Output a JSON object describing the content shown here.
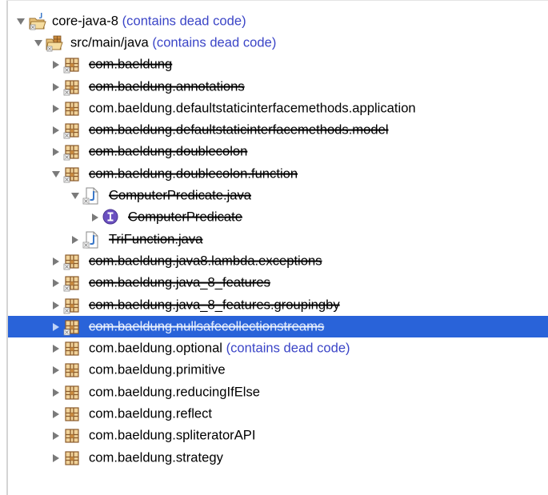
{
  "explorer": {
    "project": {
      "name": "core-java-8",
      "badge": "(contains dead code)"
    },
    "source_folder": {
      "name": "src/main/java",
      "badge": "(contains dead code)"
    },
    "items": [
      {
        "label": "com.baeldung",
        "dead": true
      },
      {
        "label": "com.baeldung.annotations",
        "dead": true
      },
      {
        "label": "com.baeldung.defaultstaticinterfacemethods.application",
        "dead": false
      },
      {
        "label": "com.baeldung.defaultstaticinterfacemethods.model",
        "dead": true
      },
      {
        "label": "com.baeldung.doublecolon",
        "dead": true
      },
      {
        "label": "com.baeldung.doublecolon.function",
        "dead": true,
        "expanded": true
      },
      {
        "label": "ComputerPredicate.java",
        "dead": true,
        "expanded": true,
        "type": "java-file"
      },
      {
        "label": "ComputerPredicate",
        "dead": true,
        "type": "interface"
      },
      {
        "label": "TriFunction.java",
        "dead": true,
        "type": "java-file"
      },
      {
        "label": "com.baeldung.java8.lambda.exceptions",
        "dead": true
      },
      {
        "label": "com.baeldung.java_8_features",
        "dead": true
      },
      {
        "label": "com.baeldung.java_8_features.groupingby",
        "dead": true
      },
      {
        "label": "com.baeldung.nullsafecollectionstreams",
        "dead": true,
        "selected": true
      },
      {
        "label": "com.baeldung.optional",
        "dead": false,
        "badge": "(contains dead code)"
      },
      {
        "label": "com.baeldung.primitive",
        "dead": false
      },
      {
        "label": "com.baeldung.reducingIfElse",
        "dead": false
      },
      {
        "label": "com.baeldung.reflect",
        "dead": false
      },
      {
        "label": "com.baeldung.spliteratorAPI",
        "dead": false
      },
      {
        "label": "com.baeldung.strategy",
        "dead": false
      }
    ],
    "colors": {
      "selection": "#2963d9",
      "badge_text": "#3b45c7",
      "package_brown": "#8a5a2b",
      "package_fill": "#f1d39a",
      "java_file_blue": "#3b78c9",
      "interface_purple": "#6a4fc0"
    },
    "icons": [
      "project-icon",
      "source-folder-icon",
      "package-icon",
      "java-file-icon",
      "interface-icon",
      "chevron-right-icon",
      "chevron-down-icon"
    ]
  }
}
